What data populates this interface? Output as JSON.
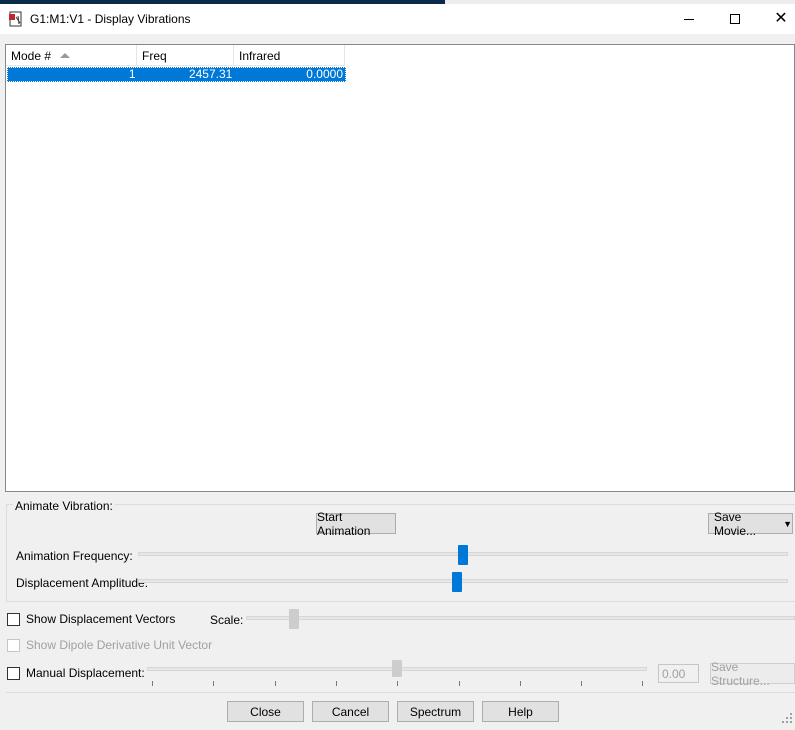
{
  "window": {
    "title": "G1:M1:V1 - Display Vibrations",
    "app_icon": "gaussview-document-icon",
    "minimize_icon": "minimize-icon",
    "maximize_icon": "maximize-icon",
    "close_glyph": "✕"
  },
  "table": {
    "columns": [
      "Mode #",
      "Freq",
      "Infrared"
    ],
    "sort_column": "Mode #",
    "sort_direction": "ascending",
    "rows": [
      {
        "mode": "1",
        "freq": "2457.31",
        "infrared": "0.0000",
        "selected": true
      }
    ]
  },
  "animate": {
    "group_label": "Animate Vibration:",
    "start_button": "Start Animation",
    "save_movie_button": "Save Movie...",
    "save_movie_arrow": "▼",
    "frequency_label": "Animation Frequency:",
    "frequency_level": 0.5,
    "amplitude_label": "Displacement Amplitude:",
    "amplitude_level": 0.49
  },
  "options": {
    "show_vectors_label": "Show Displacement Vectors",
    "show_vectors_checked": false,
    "scale_label": "Scale:",
    "scale_level": 0.08,
    "show_dipole_label": "Show Dipole Derivative Unit Vector",
    "show_dipole_checked": false,
    "show_dipole_enabled": false,
    "manual_label": "Manual Displacement:",
    "manual_checked": false,
    "manual_level": 0.5,
    "manual_value": "0.00",
    "save_structure_button": "Save Structure..."
  },
  "buttons": {
    "close": "Close",
    "cancel": "Cancel",
    "spectrum": "Spectrum",
    "help": "Help"
  },
  "colors": {
    "selection": "#0078d7",
    "slider_thumb": "#0078d7"
  }
}
